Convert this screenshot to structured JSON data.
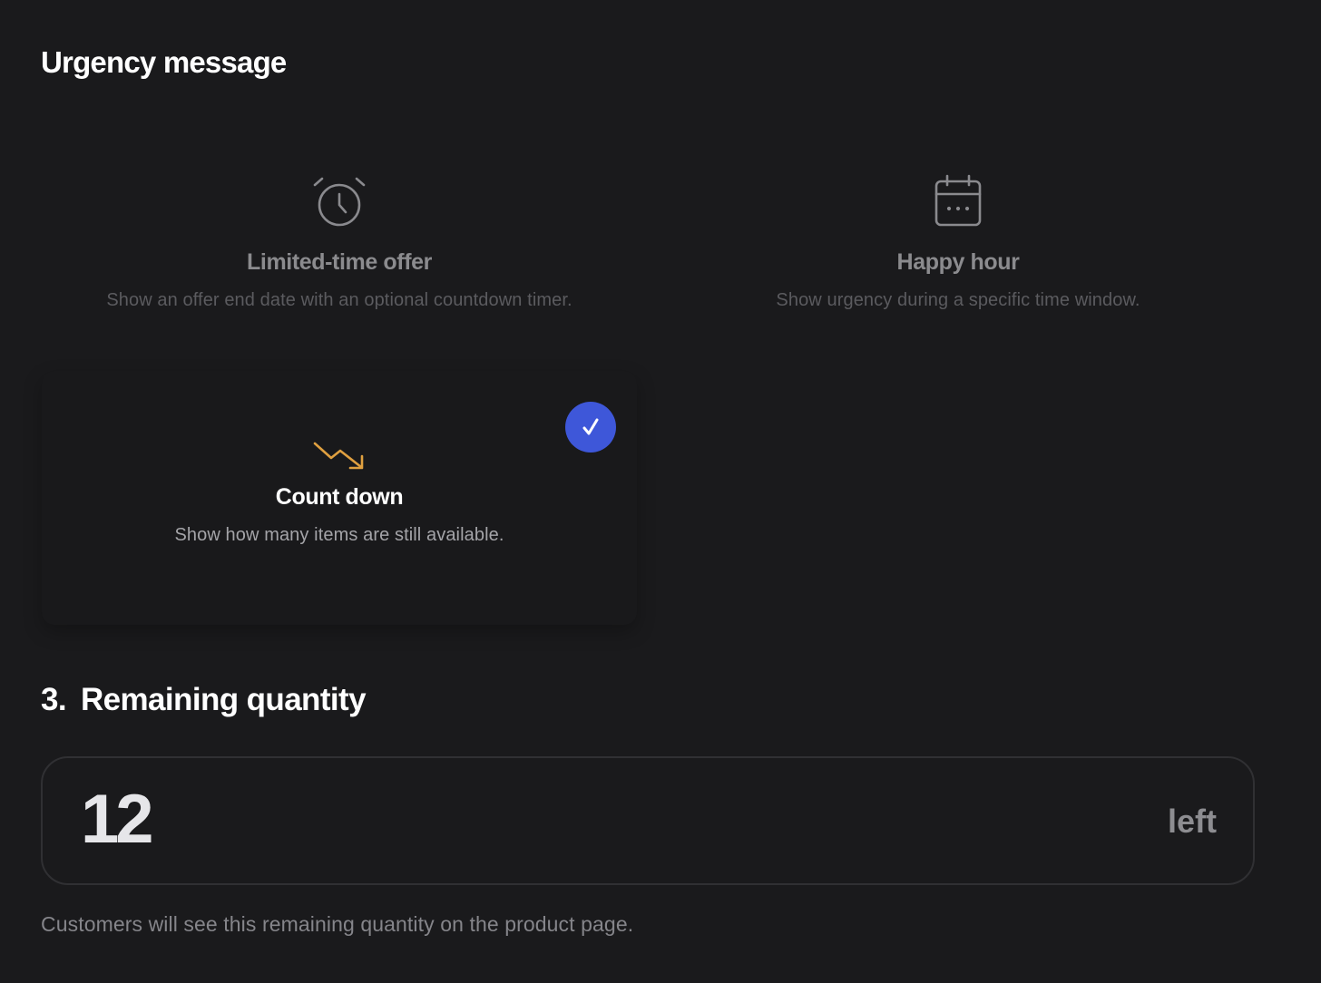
{
  "section": {
    "title": "Urgency message"
  },
  "options": [
    {
      "icon": "alarm-clock-icon",
      "title": "Limited-time offer",
      "description": "Show an offer end date with an optional countdown timer.",
      "selected": false
    },
    {
      "icon": "calendar-icon",
      "title": "Happy hour",
      "description": "Show urgency during a specific time window.",
      "selected": false
    },
    {
      "icon": "trend-down-icon",
      "title": "Count down",
      "description": "Show how many items are still available.",
      "selected": true
    }
  ],
  "check_icon": "checkmark-icon",
  "quantity": {
    "step_number": "3.",
    "title": "Remaining quantity",
    "value": "12",
    "unit": "left",
    "help": "Customers will see this remaining quantity on the product page."
  },
  "colors": {
    "background": "#1a1a1c",
    "accent": "#3e57d9",
    "trend_icon": "#e0a040",
    "muted_icon": "#8a8a8e"
  }
}
